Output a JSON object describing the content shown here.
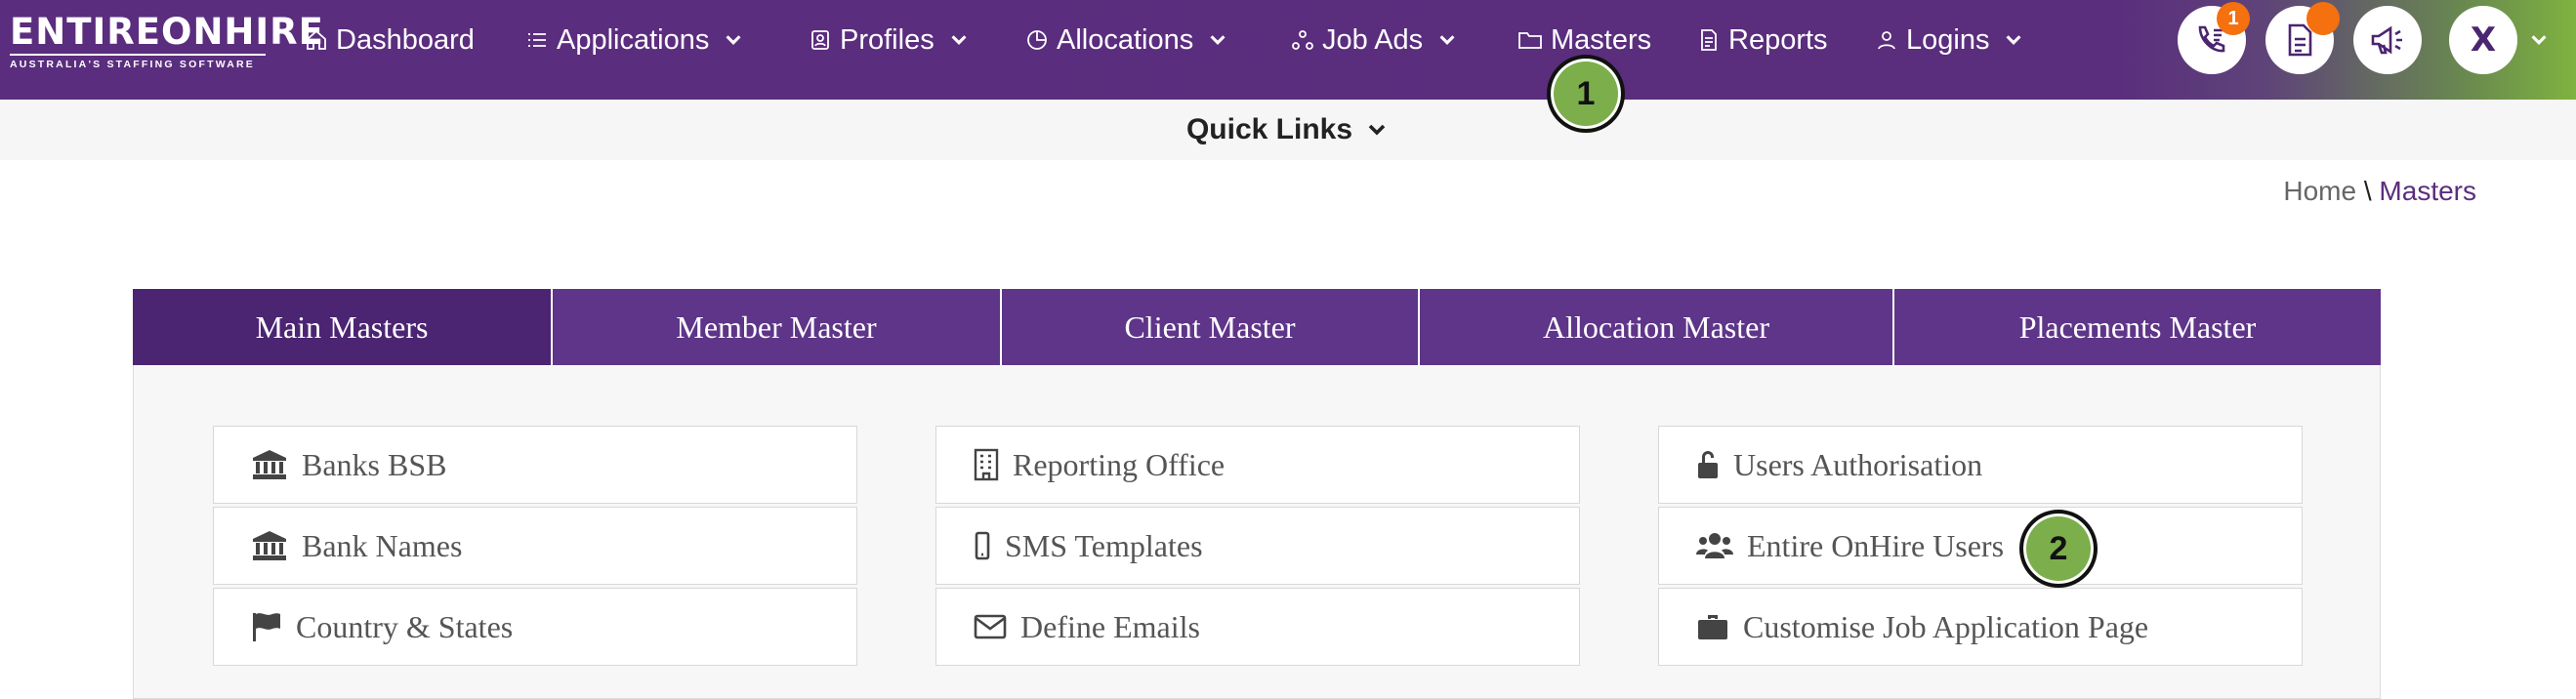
{
  "brand": {
    "name": "ENTIREONHIRE",
    "tagline": "AUSTRALIA'S STAFFING SOFTWARE"
  },
  "nav": [
    {
      "label": "Dashboard",
      "icon": "home-icon",
      "dropdown": false
    },
    {
      "label": "Applications",
      "icon": "list-icon",
      "dropdown": true
    },
    {
      "label": "Profiles",
      "icon": "id-badge-icon",
      "dropdown": true
    },
    {
      "label": "Allocations",
      "icon": "pie-icon",
      "dropdown": true
    },
    {
      "label": "Job Ads",
      "icon": "nodes-icon",
      "dropdown": true
    },
    {
      "label": "Masters",
      "icon": "folder-icon",
      "dropdown": false
    },
    {
      "label": "Reports",
      "icon": "document-icon",
      "dropdown": false
    },
    {
      "label": "Logins",
      "icon": "user-icon",
      "dropdown": true
    }
  ],
  "actions": {
    "call_badge": "1",
    "avatar_letter": "X"
  },
  "quick_links": "Quick Links",
  "breadcrumb": {
    "home": "Home",
    "separator": "\\",
    "current": "Masters"
  },
  "tabs": [
    "Main Masters",
    "Member Master",
    "Client Master",
    "Allocation Master",
    "Placements Master"
  ],
  "cards": {
    "col1": [
      {
        "label": "Banks BSB",
        "icon": "bank-icon"
      },
      {
        "label": "Bank Names",
        "icon": "bank-icon"
      },
      {
        "label": "Country & States",
        "icon": "flag-icon"
      }
    ],
    "col2": [
      {
        "label": "Reporting Office",
        "icon": "building-icon"
      },
      {
        "label": "SMS Templates",
        "icon": "mobile-icon"
      },
      {
        "label": "Define Emails",
        "icon": "envelope-icon"
      }
    ],
    "col3": [
      {
        "label": "Users Authorisation",
        "icon": "unlock-icon"
      },
      {
        "label": "Entire OnHire Users",
        "icon": "users-icon"
      },
      {
        "label": "Customise Job Application Page",
        "icon": "briefcase-icon"
      }
    ]
  },
  "steps": [
    "1",
    "2"
  ],
  "colors": {
    "brand_purple": "#5b2d7e",
    "tab_active": "#4b2472",
    "badge_orange": "#f5700f",
    "step_green": "#7cae4b"
  }
}
